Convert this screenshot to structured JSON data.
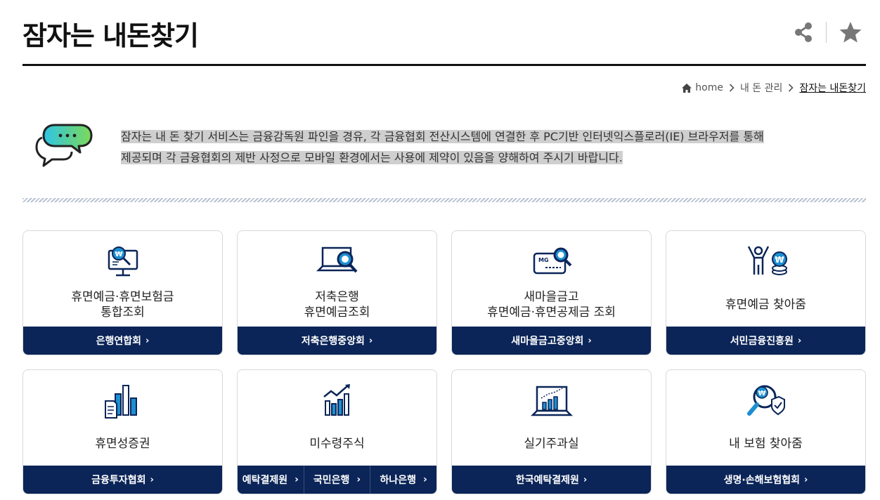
{
  "page": {
    "title": "잠자는 내돈찾기"
  },
  "tools": {
    "share_icon": "share-icon",
    "favorite_icon": "star-icon"
  },
  "breadcrumb": {
    "home": "home",
    "level1": "내 돈 관리",
    "current": "잠자는 내돈찾기"
  },
  "notice": {
    "line1": "잠자는 내 돈 찾기 서비스는 금융감독원 파인을 경유, 각 금융협회 전산시스템에 연결한 후 PC기반 인터넷익스플로러(IE) 브라우저를 통해",
    "line2": "제공되며 각 금융협회의 제반 사정으로 모바일 환경에서는 사용에 제약이 있음을 양해하여 주시기 바랍니다."
  },
  "cards": [
    {
      "icon": "monitor-won-search-icon",
      "title": [
        "휴면예금·휴면보험금",
        "통합조회"
      ],
      "button": "은행연합회"
    },
    {
      "icon": "laptop-search-icon",
      "title": [
        "저축은행",
        "휴면예금조회"
      ],
      "button": "저축은행중앙회"
    },
    {
      "icon": "mg-card-search-icon",
      "title": [
        "새마을금고",
        "휴면예금·휴면공제금 조회"
      ],
      "button": "새마을금고중앙회"
    },
    {
      "icon": "person-coins-icon",
      "title": [
        "휴면예금 찾아줌"
      ],
      "button": "서민금융진흥원"
    },
    {
      "icon": "document-bars-icon",
      "title": [
        "휴면성증권"
      ],
      "button": "금융투자협회"
    },
    {
      "icon": "growth-chart-icon",
      "title": [
        "미수령주식"
      ],
      "buttons": [
        "예탁결제원",
        "국민은행",
        "하나은행"
      ]
    },
    {
      "icon": "presentation-chart-icon",
      "title": [
        "실기주과실"
      ],
      "button": "한국예탁결제원"
    },
    {
      "icon": "magnifier-shield-icon",
      "title": [
        "내 보험 찾아줌"
      ],
      "button": "생명·손해보험협회"
    }
  ]
}
